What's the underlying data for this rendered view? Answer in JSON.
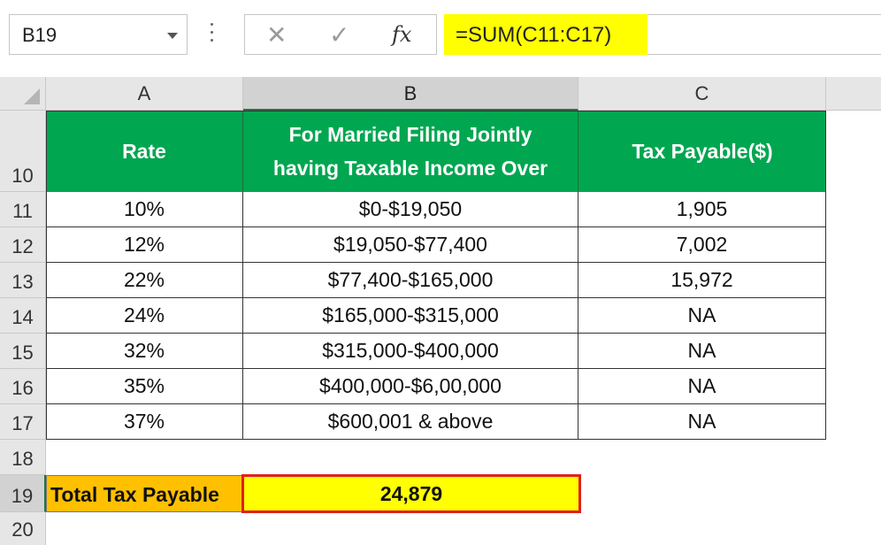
{
  "formula_bar": {
    "name_box": "B19",
    "formula": "=SUM(C11:C17)",
    "fx_label": "fx",
    "cancel_icon": "✕",
    "enter_icon": "✓"
  },
  "columns": [
    "A",
    "B",
    "C"
  ],
  "rows": [
    "10",
    "11",
    "12",
    "13",
    "14",
    "15",
    "16",
    "17",
    "18",
    "19",
    "20"
  ],
  "table": {
    "headers": [
      "Rate",
      "For Married Filing Jointly having Taxable Income Over",
      "Tax Payable($)"
    ],
    "rows": [
      [
        "10%",
        "$0-$19,050",
        "1,905"
      ],
      [
        "12%",
        "$19,050-$77,400",
        "7,002"
      ],
      [
        "22%",
        "$77,400-$165,000",
        "15,972"
      ],
      [
        "24%",
        "$165,000-$315,000",
        "NA"
      ],
      [
        "32%",
        "$315,000-$400,000",
        "NA"
      ],
      [
        "35%",
        "$400,000-$6,00,000",
        "NA"
      ],
      [
        "37%",
        "$600,001 & above",
        "NA"
      ]
    ]
  },
  "total": {
    "label": "Total Tax Payable",
    "value": "24,879"
  },
  "colors": {
    "header_fill": "#00a650",
    "total_label_fill": "#ffc000",
    "total_value_fill": "#ffff00",
    "selection_border": "#e02020",
    "formula_highlight": "#ffff00"
  }
}
